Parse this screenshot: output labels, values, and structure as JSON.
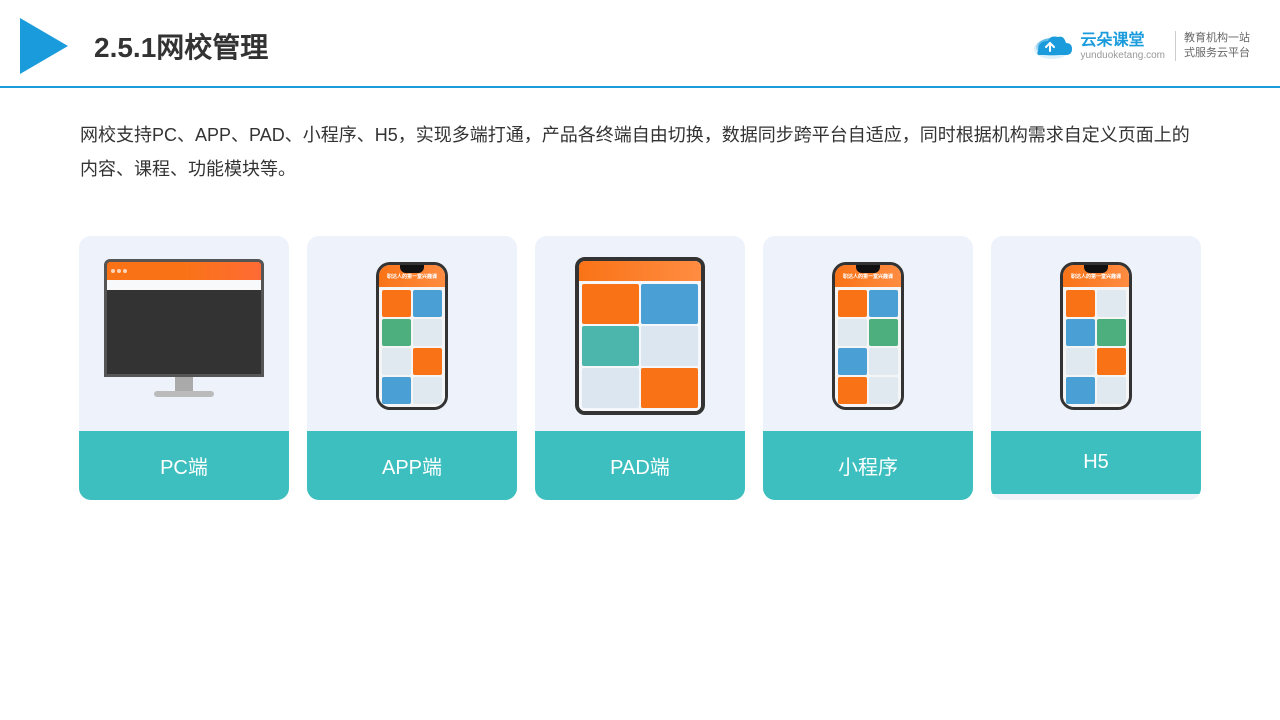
{
  "header": {
    "title": "2.5.1网校管理",
    "brand_name": "云朵课堂",
    "brand_domain": "yunduoketang.com",
    "brand_slogan": "教育机构一站\n式服务云平台"
  },
  "description": {
    "text": "网校支持PC、APP、PAD、小程序、H5，实现多端打通，产品各终端自由切换，数据同步跨平台自适应，同时根据机构需求自定义页面上的内容、课程、功能模块等。"
  },
  "cards": [
    {
      "id": "pc",
      "label": "PC端"
    },
    {
      "id": "app",
      "label": "APP端"
    },
    {
      "id": "pad",
      "label": "PAD端"
    },
    {
      "id": "miniprogram",
      "label": "小程序"
    },
    {
      "id": "h5",
      "label": "H5"
    }
  ]
}
